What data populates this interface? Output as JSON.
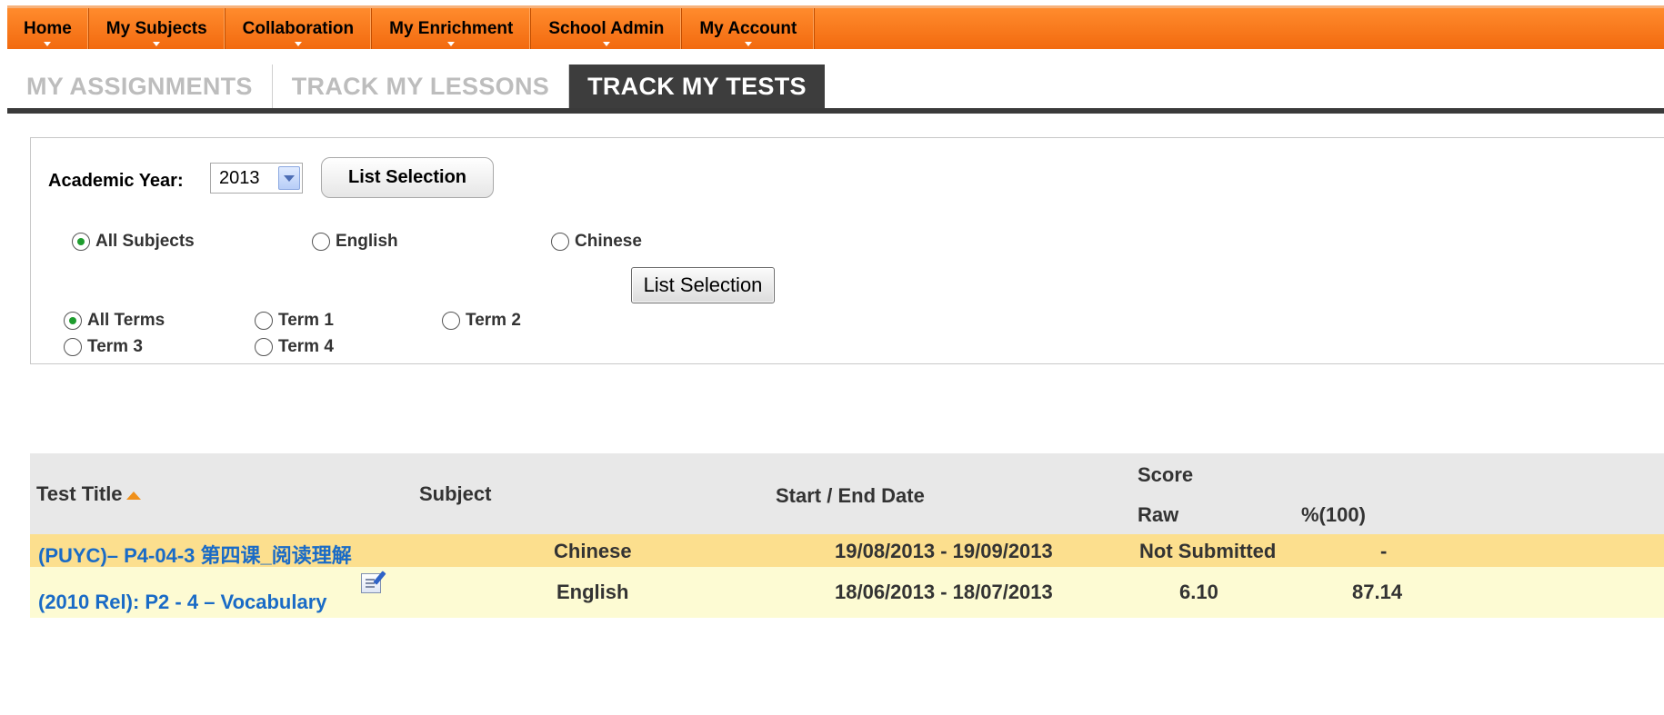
{
  "topnav": {
    "items": [
      "Home",
      "My Subjects",
      "Collaboration",
      "My Enrichment",
      "School Admin",
      "My Account"
    ]
  },
  "subtabs": {
    "items": [
      "MY ASSIGNMENTS",
      "TRACK MY LESSONS",
      "TRACK MY TESTS"
    ],
    "active": "TRACK MY TESTS"
  },
  "filters": {
    "academic_year_label": "Academic Year:",
    "academic_year_value": "2013",
    "list_selection_top": "List Selection",
    "list_selection_mid": "List Selection",
    "subjects": [
      {
        "label": "All Subjects",
        "checked": true
      },
      {
        "label": "English",
        "checked": false
      },
      {
        "label": "Chinese",
        "checked": false
      }
    ],
    "terms": [
      {
        "label": "All Terms",
        "checked": true
      },
      {
        "label": "Term 1",
        "checked": false
      },
      {
        "label": "Term 2",
        "checked": false
      },
      {
        "label": "Term 3",
        "checked": false
      },
      {
        "label": "Term 4",
        "checked": false
      }
    ]
  },
  "table": {
    "headers": {
      "title": "Test Title",
      "subject": "Subject",
      "dates": "Start / End Date",
      "score": "Score",
      "raw": "Raw",
      "percent": "%(100)"
    },
    "rows": [
      {
        "title": "(PUYC)– P4-04-3 第四课_阅读理解",
        "subject": "Chinese",
        "dates": "19/08/2013 - 19/09/2013",
        "raw": "Not Submitted",
        "percent": "-"
      },
      {
        "title": "(2010 Rel): P2 - 4 – Vocabulary",
        "subject": "English",
        "dates": "18/06/2013 - 18/07/2013",
        "raw": "6.10",
        "percent": "87.14"
      }
    ]
  },
  "colors": {
    "nav_orange": "#f57a1f",
    "active_tab_bg": "#3d3d3d",
    "row_highlight": "#fcdf8e",
    "row_alt": "#fdfbd3",
    "link_blue": "#1a6bc6"
  }
}
